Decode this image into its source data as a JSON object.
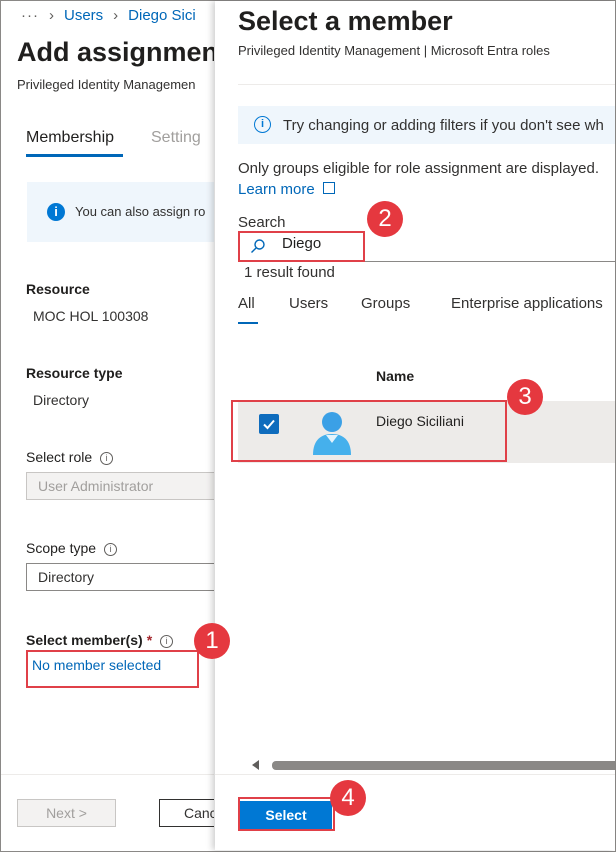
{
  "breadcrumb": {
    "more": "···",
    "items": [
      "Users",
      "Diego Sici"
    ]
  },
  "left": {
    "title": "Add assignmen",
    "subtitle": "Privileged Identity Managemen",
    "tabs": [
      "Membership",
      "Setting"
    ],
    "info_text": "You can also assign ro",
    "resource_label": "Resource",
    "resource_value": "MOC HOL 100308",
    "resource_type_label": "Resource type",
    "resource_type_value": "Directory",
    "select_role_label": "Select role",
    "select_role_value": "User Administrator",
    "scope_type_label": "Scope type",
    "scope_type_value": "Directory",
    "select_members_label": "Select member(s)",
    "required_mark": "*",
    "no_member_link": "No member selected",
    "next_button": "Next >",
    "cancel_button": "Canc"
  },
  "panel": {
    "title": "Select a member",
    "subtitle": "Privileged Identity Management | Microsoft Entra roles",
    "info_text": "Try changing or adding filters if you don't see wh",
    "note": "Only groups eligible for role assignment are displayed.",
    "learn_more": "Learn more",
    "search_label": "Search",
    "search_value": "Diego",
    "result_count": "1 result found",
    "filter_tabs": [
      "All",
      "Users",
      "Groups",
      "Enterprise applications"
    ],
    "column_name": "Name",
    "results": [
      {
        "name": "Diego Siciliani",
        "selected": true
      }
    ],
    "select_button": "Select"
  },
  "callouts": [
    "1",
    "2",
    "3",
    "4"
  ],
  "colors": {
    "accent": "#0078d4",
    "link": "#0067b8",
    "callout": "#e5383f",
    "highlight_border": "#e04048"
  }
}
